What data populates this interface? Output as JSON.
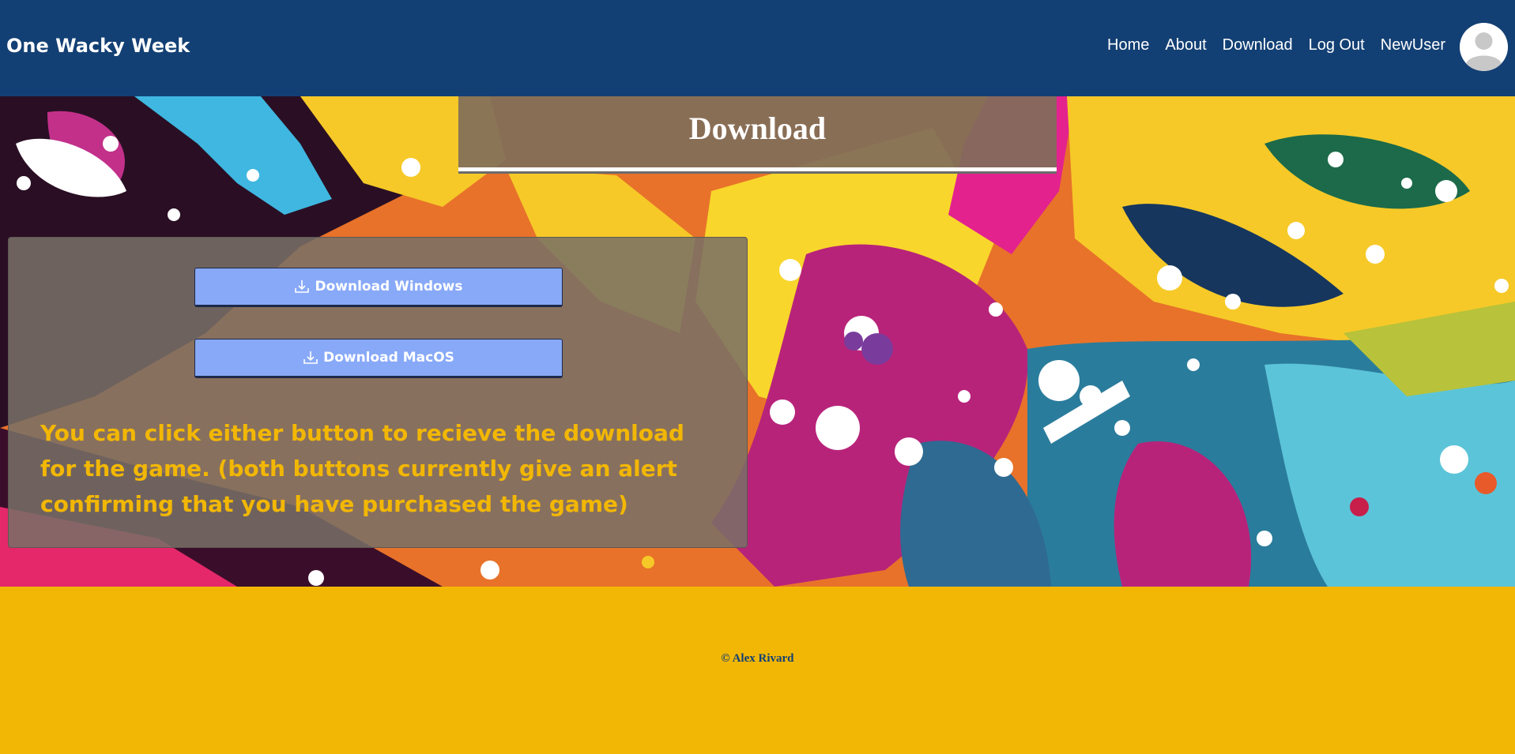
{
  "navbar": {
    "brand": "One Wacky Week",
    "links": [
      "Home",
      "About",
      "Download",
      "Log Out",
      "NewUser"
    ]
  },
  "page": {
    "title": "Download"
  },
  "downloads": {
    "windows_label": "Download Windows",
    "mac_label": "Download MacOS",
    "note": "You can click either button to recieve the download for the game. (both buttons currently give an alert confirming that you have purchased the game)"
  },
  "footer": {
    "copyright": "© Alex Rivard"
  },
  "colors": {
    "navbar": "#134074",
    "accent": "#f2b705",
    "button": "#88a9f8"
  },
  "icons": [
    "user-avatar-icon",
    "download-icon"
  ]
}
